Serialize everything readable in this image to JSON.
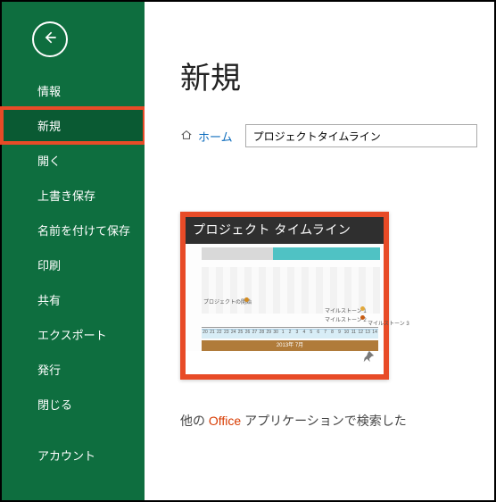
{
  "sidebar": {
    "items": [
      {
        "label": "情報"
      },
      {
        "label": "新規",
        "selected": true
      },
      {
        "label": "開く"
      },
      {
        "label": "上書き保存"
      },
      {
        "label": "名前を付けて保存"
      },
      {
        "label": "印刷"
      },
      {
        "label": "共有"
      },
      {
        "label": "エクスポート"
      },
      {
        "label": "発行"
      },
      {
        "label": "閉じる"
      },
      {
        "label": "アカウント"
      }
    ]
  },
  "page": {
    "title": "新規",
    "home_label": "ホーム",
    "search_value": "プロジェクトタイムライン"
  },
  "template": {
    "title": "プロジェクト タイムライン",
    "preview": {
      "phase1_label": "プロジェクトの開始",
      "milestones": [
        {
          "label": "マイルストーン 1",
          "color": "#e1a83a"
        },
        {
          "label": "マイルストーン 2",
          "color": "#c75c13"
        },
        {
          "label": "マイルストーン 3",
          "color": "#5aa9d6"
        }
      ],
      "day_ticks": [
        "20",
        "21",
        "22",
        "23",
        "24",
        "25",
        "26",
        "27",
        "28",
        "29",
        "30",
        "1",
        "2",
        "3",
        "4",
        "5",
        "6",
        "7",
        "8",
        "9",
        "10",
        "11",
        "12",
        "13",
        "14"
      ],
      "footer_label": "2013年 7月",
      "bar_colors": {
        "a": "#d9d9d9",
        "b": "#4fc2c4"
      }
    }
  },
  "footer": {
    "prefix": "他の ",
    "brand": "Office",
    "suffix": " アプリケーションで検索した"
  }
}
